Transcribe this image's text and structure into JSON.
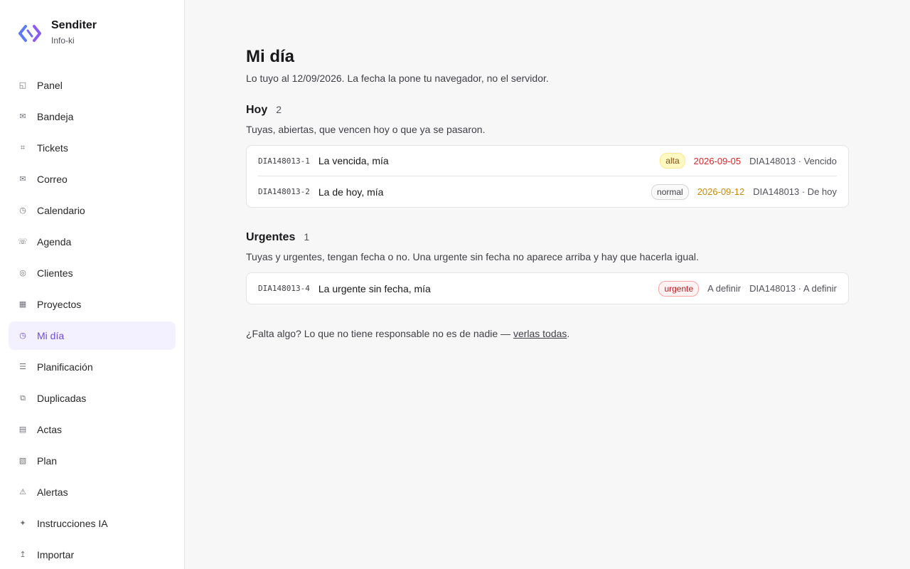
{
  "brand": {
    "name": "Senditer",
    "subtitle": "Info-ki"
  },
  "sidebar": {
    "items": [
      {
        "label": "Panel",
        "icon": "panel-icon",
        "glyph": "◱"
      },
      {
        "label": "Bandeja",
        "icon": "inbox-icon",
        "glyph": "✉"
      },
      {
        "label": "Tickets",
        "icon": "tickets-icon",
        "glyph": "⌗"
      },
      {
        "label": "Correo",
        "icon": "mail-icon",
        "glyph": "✉"
      },
      {
        "label": "Calendario",
        "icon": "calendar-icon",
        "glyph": "◷"
      },
      {
        "label": "Agenda",
        "icon": "phone-icon",
        "glyph": "☏"
      },
      {
        "label": "Clientes",
        "icon": "clients-icon",
        "glyph": "◎"
      },
      {
        "label": "Proyectos",
        "icon": "projects-icon",
        "glyph": "▦"
      },
      {
        "label": "Mi día",
        "icon": "clock-icon",
        "glyph": "◷",
        "active": true
      },
      {
        "label": "Planificación",
        "icon": "list-icon",
        "glyph": "☰"
      },
      {
        "label": "Duplicadas",
        "icon": "duplicate-icon",
        "glyph": "⧉"
      },
      {
        "label": "Actas",
        "icon": "minutes-icon",
        "glyph": "▤"
      },
      {
        "label": "Plan",
        "icon": "plan-icon",
        "glyph": "▧"
      },
      {
        "label": "Alertas",
        "icon": "alert-icon",
        "glyph": "⚠"
      },
      {
        "label": "Instrucciones IA",
        "icon": "sparkle-icon",
        "glyph": "✦"
      },
      {
        "label": "Importar",
        "icon": "import-icon",
        "glyph": "↥"
      }
    ]
  },
  "colors": {
    "accent": "#6d4fd8",
    "overdue": "#dc2626",
    "today": "#ca8a04"
  },
  "page": {
    "title": "Mi día",
    "subtitle": "Lo tuyo al 12/09/2026. La fecha la pone tu navegador, no el servidor."
  },
  "sections": {
    "hoy": {
      "title": "Hoy",
      "count": "2",
      "description": "Tuyas, abiertas, que vencen hoy o que ya se pasaron.",
      "rows": [
        {
          "id": "DIA148013-1",
          "title": "La vencida, mía",
          "priority": "alta",
          "date": "2026-09-05",
          "meta": "DIA148013 · Vencido"
        },
        {
          "id": "DIA148013-2",
          "title": "La de hoy, mía",
          "priority": "normal",
          "date": "2026-09-12",
          "meta": "DIA148013 · De hoy"
        }
      ]
    },
    "urgentes": {
      "title": "Urgentes",
      "count": "1",
      "description": "Tuyas y urgentes, tengan fecha o no. Una urgente sin fecha no aparece arriba y hay que hacerla igual.",
      "rows": [
        {
          "id": "DIA148013-4",
          "title": "La urgente sin fecha, mía",
          "priority": "urgente",
          "date": "A definir",
          "meta": "DIA148013 · A definir"
        }
      ]
    }
  },
  "footer": {
    "text": "¿Falta algo? Lo que no tiene responsable no es de nadie — ",
    "link": "verlas todas",
    "end": "."
  }
}
